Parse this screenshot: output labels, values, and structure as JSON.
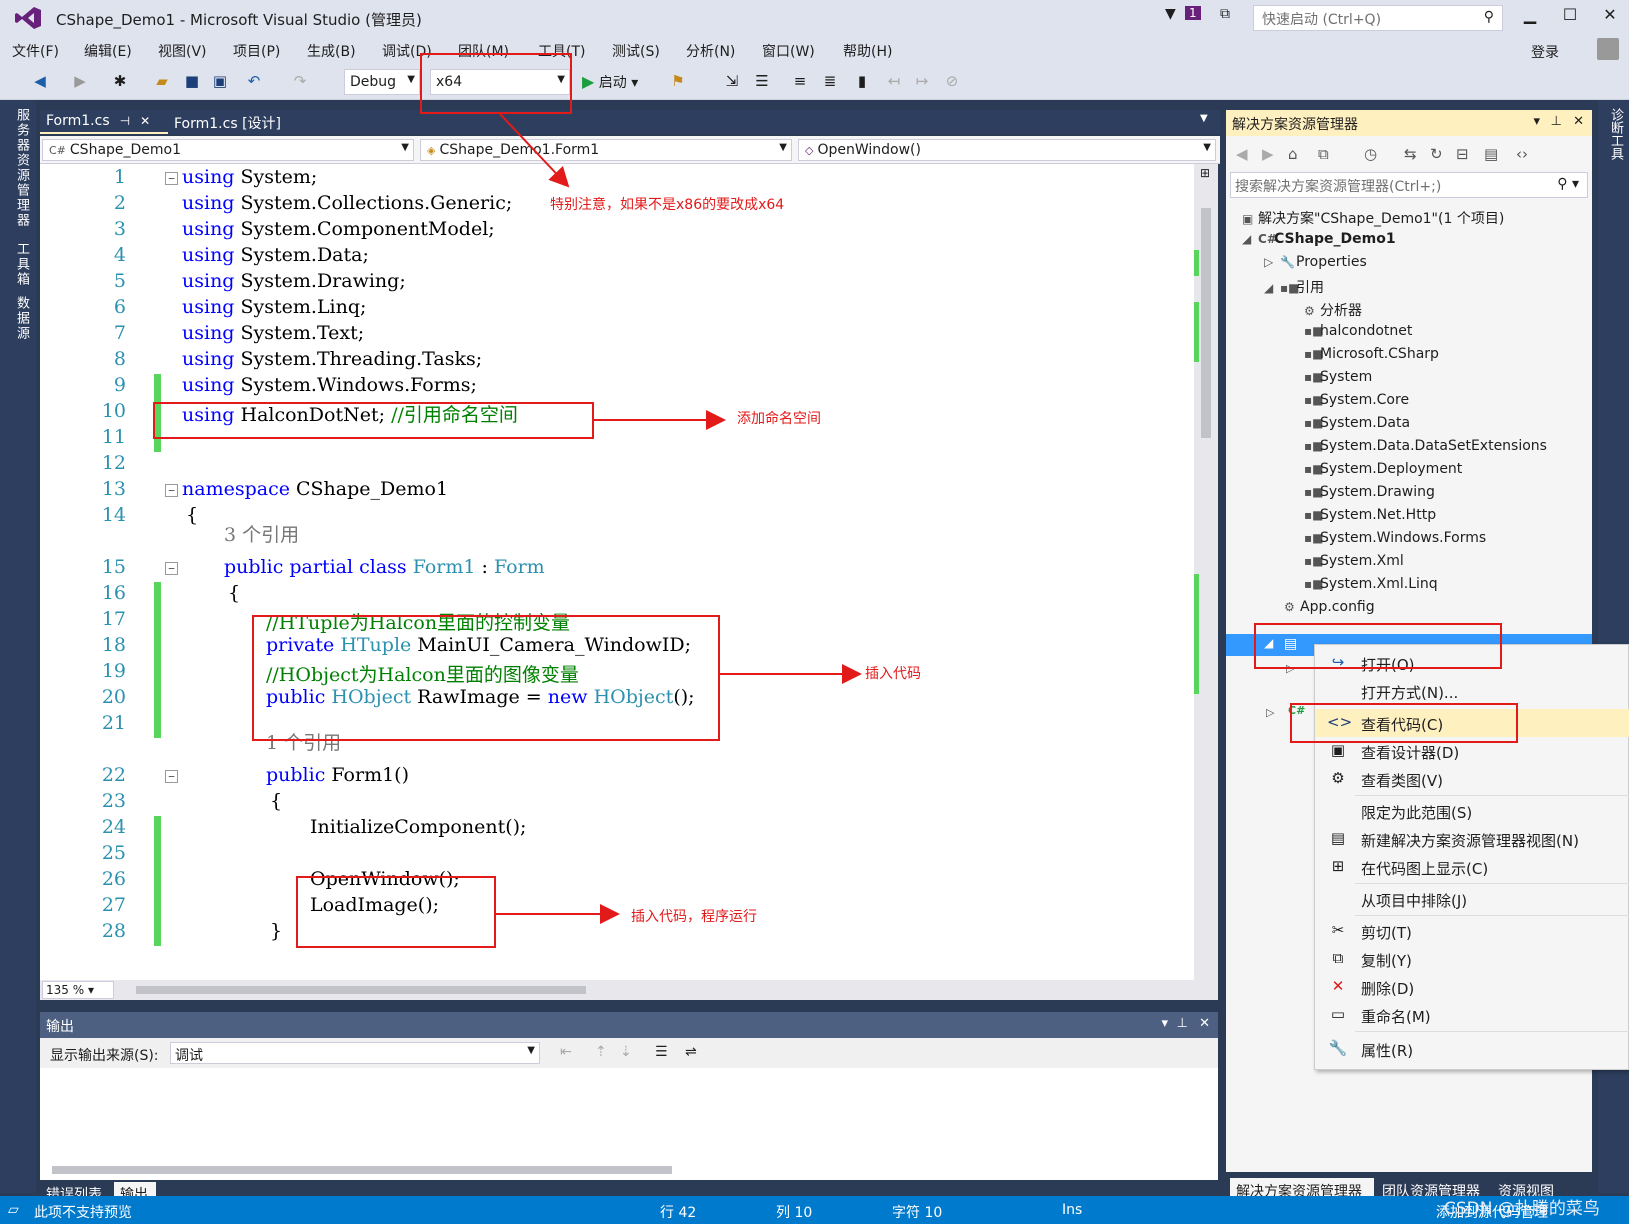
{
  "window": {
    "title": "CShape_Demo1 - Microsoft Visual Studio (管理员)",
    "quick_launch_placeholder": "快速启动 (Ctrl+Q)",
    "notification_count": "1",
    "login": "登录"
  },
  "menu": [
    "文件(F)",
    "编辑(E)",
    "视图(V)",
    "项目(P)",
    "生成(B)",
    "调试(D)",
    "团队(M)",
    "工具(T)",
    "测试(S)",
    "分析(N)",
    "窗口(W)",
    "帮助(H)"
  ],
  "toolbar": {
    "config": "Debug",
    "platform": "x64",
    "start": "启动"
  },
  "left_sidebar": [
    "服务器资源管理器",
    "工具箱",
    "数据源"
  ],
  "right_sidebar": [
    "诊断工具"
  ],
  "editor_tabs": [
    {
      "label": "Form1.cs",
      "active": true
    },
    {
      "label": "Form1.cs [设计]",
      "active": false
    }
  ],
  "navbar": {
    "project": "CShape_Demo1",
    "class": "CShape_Demo1.Form1",
    "member": "OpenWindow()"
  },
  "code_lines": [
    {
      "n": "1",
      "t": "using System;"
    },
    {
      "n": "2",
      "t": "using System.Collections.Generic;"
    },
    {
      "n": "3",
      "t": "using System.ComponentModel;"
    },
    {
      "n": "4",
      "t": "using System.Data;"
    },
    {
      "n": "5",
      "t": "using System.Drawing;"
    },
    {
      "n": "6",
      "t": "using System.Linq;"
    },
    {
      "n": "7",
      "t": "using System.Text;"
    },
    {
      "n": "8",
      "t": "using System.Threading.Tasks;"
    },
    {
      "n": "9",
      "t": "using System.Windows.Forms;"
    },
    {
      "n": "10",
      "t": "using HalconDotNet; //引用命名空间"
    },
    {
      "n": "11",
      "t": ""
    },
    {
      "n": "12",
      "t": ""
    },
    {
      "n": "13",
      "t": "namespace CShape_Demo1"
    },
    {
      "n": "14",
      "t": "{"
    },
    {
      "n": "15",
      "t": "public partial class Form1 : Form"
    },
    {
      "n": "16",
      "t": "{"
    },
    {
      "n": "17",
      "t": "//HTuple为Halcon里面的控制变量"
    },
    {
      "n": "18",
      "t": "private HTuple MainUI_Camera_WindowID;"
    },
    {
      "n": "19",
      "t": "//HObject为Halcon里面的图像变量"
    },
    {
      "n": "20",
      "t": "public HObject RawImage = new HObject();"
    },
    {
      "n": "21",
      "t": ""
    },
    {
      "n": "22",
      "t": "public Form1()"
    },
    {
      "n": "23",
      "t": "{"
    },
    {
      "n": "24",
      "t": "InitializeComponent();"
    },
    {
      "n": "25",
      "t": ""
    },
    {
      "n": "26",
      "t": "OpenWindow();"
    },
    {
      "n": "27",
      "t": "LoadImage();"
    },
    {
      "n": "28",
      "t": "}"
    }
  ],
  "codelens": [
    "3 个引用",
    "1 个引用"
  ],
  "zoom": "135 %",
  "output": {
    "title": "输出",
    "source_label": "显示输出来源(S):",
    "source_value": "调试"
  },
  "bottom_tabs": [
    "错误列表",
    "输出"
  ],
  "solution_explorer": {
    "title": "解决方案资源管理器",
    "search_placeholder": "搜索解决方案资源管理器(Ctrl+;)",
    "solution": "解决方案\"CShape_Demo1\"(1 个项目)",
    "project": "CShape_Demo1",
    "properties": "Properties",
    "references": "引用",
    "analyzers": "分析器",
    "refs": [
      "halcondotnet",
      "Microsoft.CSharp",
      "System",
      "System.Core",
      "System.Data",
      "System.Data.DataSetExtensions",
      "System.Deployment",
      "System.Drawing",
      "System.Net.Http",
      "System.Windows.Forms",
      "System.Xml",
      "System.Xml.Linq"
    ],
    "app_config": "App.config"
  },
  "se_tabs": [
    "解决方案资源管理器",
    "团队资源管理器",
    "资源视图"
  ],
  "context_menu": [
    {
      "icon": "↪",
      "label": "打开(O)",
      "highlight": false
    },
    {
      "icon": "",
      "label": "打开方式(N)...",
      "highlight": false
    },
    {
      "icon": "<>",
      "label": "查看代码(C)",
      "highlight": true
    },
    {
      "icon": "▣",
      "label": "查看设计器(D)",
      "highlight": false
    },
    {
      "icon": "⚙",
      "label": "查看类图(V)",
      "highlight": false
    },
    {
      "icon": "",
      "label": "限定为此范围(S)",
      "highlight": false
    },
    {
      "icon": "▤",
      "label": "新建解决方案资源管理器视图(N)",
      "highlight": false
    },
    {
      "icon": "⊞",
      "label": "在代码图上显示(C)",
      "highlight": false
    },
    {
      "icon": "",
      "label": "从项目中排除(J)",
      "highlight": false
    },
    {
      "icon": "✂",
      "label": "剪切(T)",
      "highlight": false
    },
    {
      "icon": "⧉",
      "label": "复制(Y)",
      "highlight": false
    },
    {
      "icon": "✕",
      "label": "删除(D)",
      "highlight": false
    },
    {
      "icon": "▭",
      "label": "重命名(M)",
      "highlight": false
    },
    {
      "icon": "🔧",
      "label": "属性(R)",
      "highlight": false
    }
  ],
  "status": {
    "left": "此项不支持预览",
    "row": "行 42",
    "col": "列 10",
    "char": "字符 10",
    "mode": "Ins",
    "right": "添加到源代码管理"
  },
  "annotations": {
    "x64_note": "特别注意，如果不是x86的要改成x64",
    "namespace_note": "添加命名空间",
    "insert_note": "插入代码",
    "run_note": "插入代码，程序运行"
  },
  "watermark": "CSDN @扑腾的菜鸟",
  "colors": {
    "accent": "#007acc",
    "annotation": "#e21a1a",
    "keyword": "#0000ff",
    "type": "#2b91af",
    "comment": "#008000",
    "changed_bar": "#57d55c"
  }
}
